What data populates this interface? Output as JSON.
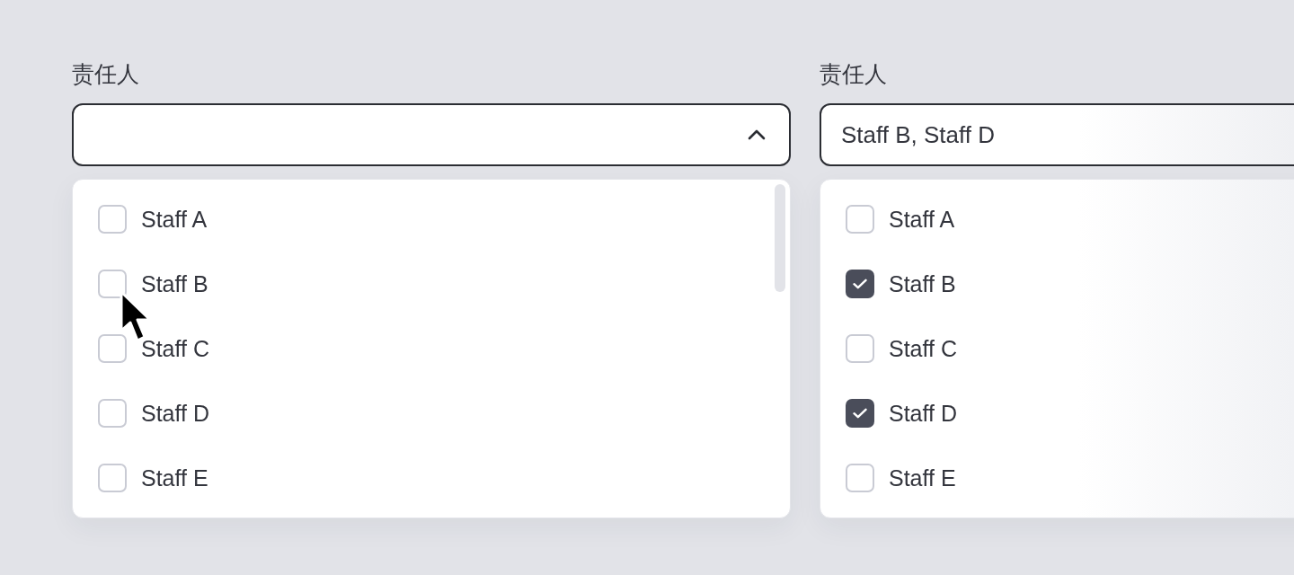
{
  "fields": [
    {
      "label": "责任人",
      "expanded": true,
      "options": [
        {
          "label": "Staff A",
          "checked": false
        },
        {
          "label": "Staff B",
          "checked": false
        },
        {
          "label": "Staff C",
          "checked": false
        },
        {
          "label": "Staff D",
          "checked": false
        },
        {
          "label": "Staff E",
          "checked": false
        }
      ]
    },
    {
      "label": "责任人",
      "value": "Staff B, Staff D",
      "expanded": true,
      "options": [
        {
          "label": "Staff A",
          "checked": false
        },
        {
          "label": "Staff B",
          "checked": true
        },
        {
          "label": "Staff C",
          "checked": false
        },
        {
          "label": "Staff D",
          "checked": true
        },
        {
          "label": "Staff E",
          "checked": false
        }
      ]
    }
  ]
}
